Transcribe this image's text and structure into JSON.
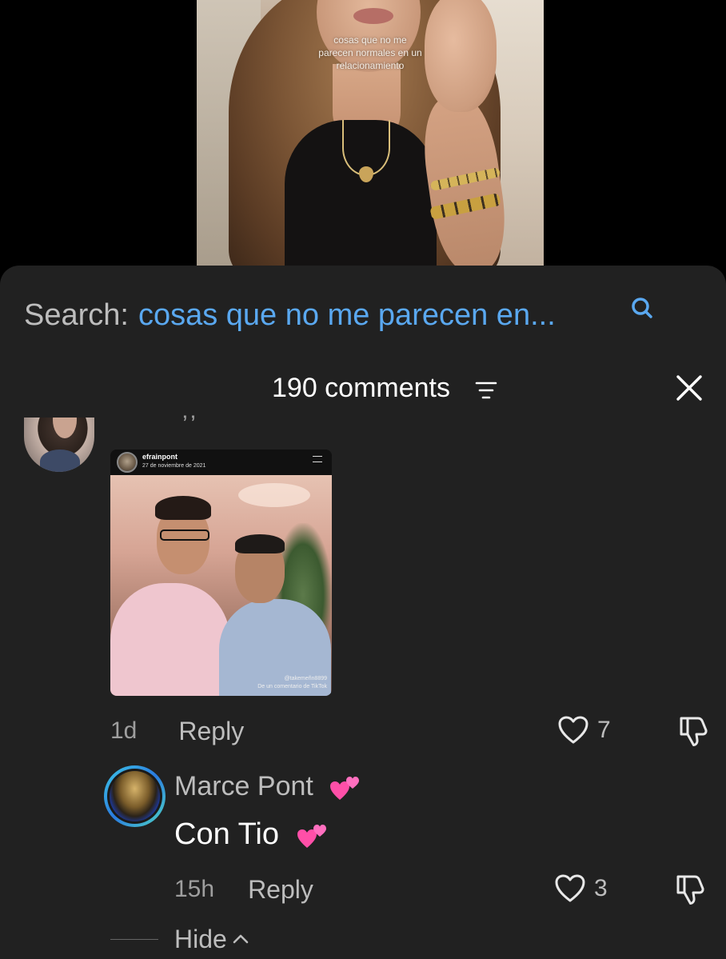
{
  "video": {
    "caption": "cosas que no me parecen normales en un relacionamiento"
  },
  "search": {
    "label": "Search:",
    "query": "cosas que no me parecen en...",
    "icon": "search-icon",
    "query_color": "#5aa8f0"
  },
  "comments_header": {
    "count_label": "190 comments",
    "sort_icon": "sort-icon",
    "close_icon": "close-icon"
  },
  "comment_1": {
    "quote_marks": "’’",
    "post_image": {
      "username": "efrainpont",
      "date": "27 de noviembre de 2021",
      "watermark_handle": "@takemeñn8899",
      "watermark_text": "De un comentario de TikTok"
    },
    "time": "1d",
    "reply_label": "Reply",
    "like_count": "7"
  },
  "comment_2": {
    "username": "Marce Pont",
    "username_emoji": "💕",
    "text": "Con Tio",
    "text_emoji": "💕",
    "time": "15h",
    "reply_label": "Reply",
    "like_count": "3"
  },
  "hide": {
    "label": "Hide"
  },
  "colors": {
    "sheet_bg": "#212121",
    "accent_link": "#5aa8f0",
    "ring_gradient": "#3ec8e6"
  }
}
